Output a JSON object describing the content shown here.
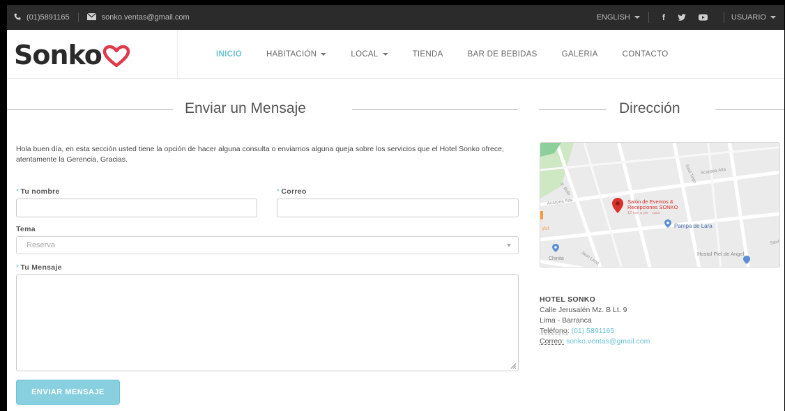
{
  "topbar": {
    "phone": "(01)5891165",
    "email": "sonko.ventas@gmail.com",
    "language": "ENGLISH",
    "user": "USUARIO"
  },
  "brand": {
    "logo_text": "Sonko",
    "accent": "#6cc3d5",
    "heart_color": "#e03a4a"
  },
  "nav": {
    "items": [
      {
        "label": "INICIO"
      },
      {
        "label": "HABITACIÓN"
      },
      {
        "label": "LOCAL"
      },
      {
        "label": "TIENDA"
      },
      {
        "label": "BAR DE BEBIDAS"
      },
      {
        "label": "GALERIA"
      },
      {
        "label": "CONTACTO"
      }
    ]
  },
  "form": {
    "title": "Enviar un Mensaje",
    "intro": "Hola buen día, en esta sección usted tiene la opción de hacer alguna consulta o enviarnos alguna queja sobre los servicios que el Hotel Sonko ofrece, atentamente la Gerencia, Gracias.",
    "name_label": "Tu nombre",
    "email_label": "Correo",
    "topic_label": "Tema",
    "topic_value": "Reserva",
    "message_label": "Tu Mensaje",
    "required_mark": "*",
    "submit_label": "ENVIAR MENSAJE"
  },
  "address": {
    "title": "Dirección",
    "hotel": "HOTEL SONKO",
    "line1": "Calle Jerusalén Mz. B Lt. 9",
    "line2": "Lima - Barranca",
    "phone_key": "Teléfono:",
    "phone_value": "(01) 5891165",
    "email_key": "Correo:",
    "email_value": "sonko.ventas@gmail.com"
  },
  "map": {
    "place_name_1": "Salón de Eventos &",
    "place_name_2": "Recepciones SONKO",
    "place_sub": "12 min a pie · casa",
    "place_2": "Pampa de Lara",
    "place_3": "Hostal Piel de Angel",
    "place_4": "Chinita",
    "street_1": "Acarpea Alta",
    "street_2": "Acarpea Alta",
    "street_3": "Jr. Bolo",
    "street_4": "Saul Tinto",
    "street_5": "Jaun Lima",
    "street_6": "Saul"
  }
}
